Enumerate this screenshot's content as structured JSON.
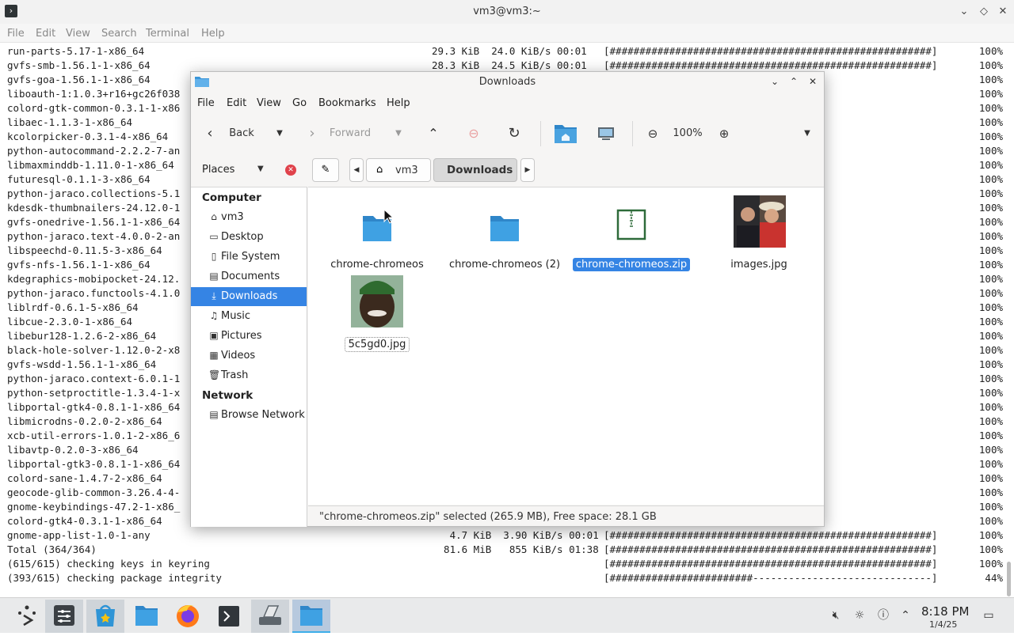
{
  "terminal": {
    "title": "vm3@vm3:~",
    "menu": [
      "File",
      "Edit",
      "View",
      "Search",
      "Terminal",
      "Help"
    ],
    "lines": [
      {
        "pkg": "run-parts-5.17-1-x86_64",
        "stats": "29.3 KiB  24.0 KiB/s 00:01",
        "bar": "[######################################################]",
        "pct": "100%"
      },
      {
        "pkg": "gvfs-smb-1.56.1-1-x86_64",
        "stats": "28.3 KiB  24.5 KiB/s 00:01",
        "bar": "[######################################################]",
        "pct": "100%"
      },
      {
        "pkg": "gvfs-goa-1.56.1-1-x86_64",
        "stats": "",
        "bar": "",
        "pct": "100%"
      },
      {
        "pkg": "liboauth-1:1.0.3+r16+gc26f038",
        "stats": "",
        "bar": "",
        "pct": "100%"
      },
      {
        "pkg": "colord-gtk-common-0.3.1-1-x86",
        "stats": "",
        "bar": "",
        "pct": "100%"
      },
      {
        "pkg": "libaec-1.1.3-1-x86_64",
        "stats": "",
        "bar": "",
        "pct": "100%"
      },
      {
        "pkg": "kcolorpicker-0.3.1-4-x86_64",
        "stats": "",
        "bar": "",
        "pct": "100%"
      },
      {
        "pkg": "python-autocommand-2.2.2-7-an",
        "stats": "",
        "bar": "",
        "pct": "100%"
      },
      {
        "pkg": "libmaxminddb-1.11.0-1-x86_64",
        "stats": "",
        "bar": "",
        "pct": "100%"
      },
      {
        "pkg": "futuresql-0.1.1-3-x86_64",
        "stats": "",
        "bar": "",
        "pct": "100%"
      },
      {
        "pkg": "python-jaraco.collections-5.1",
        "stats": "",
        "bar": "",
        "pct": "100%"
      },
      {
        "pkg": "kdesdk-thumbnailers-24.12.0-1",
        "stats": "",
        "bar": "",
        "pct": "100%"
      },
      {
        "pkg": "gvfs-onedrive-1.56.1-1-x86_64",
        "stats": "",
        "bar": "",
        "pct": "100%"
      },
      {
        "pkg": "python-jaraco.text-4.0.0-2-an",
        "stats": "",
        "bar": "",
        "pct": "100%"
      },
      {
        "pkg": "libspeechd-0.11.5-3-x86_64",
        "stats": "",
        "bar": "",
        "pct": "100%"
      },
      {
        "pkg": "gvfs-nfs-1.56.1-1-x86_64",
        "stats": "",
        "bar": "",
        "pct": "100%"
      },
      {
        "pkg": "kdegraphics-mobipocket-24.12.",
        "stats": "",
        "bar": "",
        "pct": "100%"
      },
      {
        "pkg": "python-jaraco.functools-4.1.0",
        "stats": "",
        "bar": "",
        "pct": "100%"
      },
      {
        "pkg": "liblrdf-0.6.1-5-x86_64",
        "stats": "",
        "bar": "",
        "pct": "100%"
      },
      {
        "pkg": "libcue-2.3.0-1-x86_64",
        "stats": "",
        "bar": "",
        "pct": "100%"
      },
      {
        "pkg": "libebur128-1.2.6-2-x86_64",
        "stats": "",
        "bar": "",
        "pct": "100%"
      },
      {
        "pkg": "black-hole-solver-1.12.0-2-x8",
        "stats": "",
        "bar": "",
        "pct": "100%"
      },
      {
        "pkg": "gvfs-wsdd-1.56.1-1-x86_64",
        "stats": "",
        "bar": "",
        "pct": "100%"
      },
      {
        "pkg": "python-jaraco.context-6.0.1-1",
        "stats": "",
        "bar": "",
        "pct": "100%"
      },
      {
        "pkg": "python-setproctitle-1.3.4-1-x",
        "stats": "",
        "bar": "",
        "pct": "100%"
      },
      {
        "pkg": "libportal-gtk4-0.8.1-1-x86_64",
        "stats": "",
        "bar": "",
        "pct": "100%"
      },
      {
        "pkg": "libmicrodns-0.2.0-2-x86_64",
        "stats": "",
        "bar": "",
        "pct": "100%"
      },
      {
        "pkg": "xcb-util-errors-1.0.1-2-x86_6",
        "stats": "",
        "bar": "",
        "pct": "100%"
      },
      {
        "pkg": "libavtp-0.2.0-3-x86_64",
        "stats": "",
        "bar": "",
        "pct": "100%"
      },
      {
        "pkg": "libportal-gtk3-0.8.1-1-x86_64",
        "stats": "",
        "bar": "",
        "pct": "100%"
      },
      {
        "pkg": "colord-sane-1.4.7-2-x86_64",
        "stats": "",
        "bar": "",
        "pct": "100%"
      },
      {
        "pkg": "geocode-glib-common-3.26.4-4-",
        "stats": "",
        "bar": "",
        "pct": "100%"
      },
      {
        "pkg": "gnome-keybindings-47.2-1-x86_",
        "stats": "",
        "bar": "",
        "pct": "100%"
      },
      {
        "pkg": "colord-gtk4-0.3.1-1-x86_64",
        "stats": "",
        "bar": "",
        "pct": "100%"
      },
      {
        "pkg": "gnome-app-list-1.0-1-any",
        "stats": "   4.7 KiB  3.90 KiB/s 00:01",
        "bar": "[######################################################]",
        "pct": "100%"
      },
      {
        "pkg": "Total (364/364)",
        "stats": "  81.6 MiB   855 KiB/s 01:38",
        "bar": "[######################################################]",
        "pct": "100%"
      },
      {
        "pkg": "(615/615) checking keys in keyring",
        "stats": "",
        "bar": "[######################################################]",
        "pct": "100%"
      },
      {
        "pkg": "(393/615) checking package integrity",
        "stats": "",
        "bar": "[########################------------------------------]",
        "pct": "44%"
      }
    ]
  },
  "file_manager": {
    "title": "Downloads",
    "menu": [
      "File",
      "Edit",
      "View",
      "Go",
      "Bookmarks",
      "Help"
    ],
    "toolbar": {
      "back": "Back",
      "forward": "Forward",
      "zoom": "100%"
    },
    "places_label": "Places",
    "breadcrumb": [
      "vm3",
      "Downloads"
    ],
    "sidebar": {
      "computer_heading": "Computer",
      "network_heading": "Network",
      "computer_items": [
        {
          "label": "vm3",
          "icon": "home-icon"
        },
        {
          "label": "Desktop",
          "icon": "desktop-icon"
        },
        {
          "label": "File System",
          "icon": "drive-icon"
        },
        {
          "label": "Documents",
          "icon": "documents-icon"
        },
        {
          "label": "Downloads",
          "icon": "download-icon"
        },
        {
          "label": "Music",
          "icon": "music-icon"
        },
        {
          "label": "Pictures",
          "icon": "pictures-icon"
        },
        {
          "label": "Videos",
          "icon": "videos-icon"
        },
        {
          "label": "Trash",
          "icon": "trash-icon"
        }
      ],
      "network_items": [
        {
          "label": "Browse Network",
          "icon": "network-icon"
        }
      ]
    },
    "files": [
      {
        "name": "chrome-chromeos",
        "kind": "folder"
      },
      {
        "name": "chrome-chromeos (2)",
        "kind": "folder"
      },
      {
        "name": "chrome-chromeos.zip",
        "kind": "zip",
        "selected": true
      },
      {
        "name": "images.jpg",
        "kind": "image"
      },
      {
        "name": "5c5gd0.jpg",
        "kind": "image"
      }
    ],
    "status": "\"chrome-chromeos.zip\" selected (265.9 MB), Free space: 28.1 GB"
  },
  "taskbar": {
    "time": "8:18 PM",
    "date": "1/4/25"
  },
  "colors": {
    "accent": "#3584e4",
    "folder": "#3a95d8",
    "taskbar_bg": "#e9eaeb"
  }
}
